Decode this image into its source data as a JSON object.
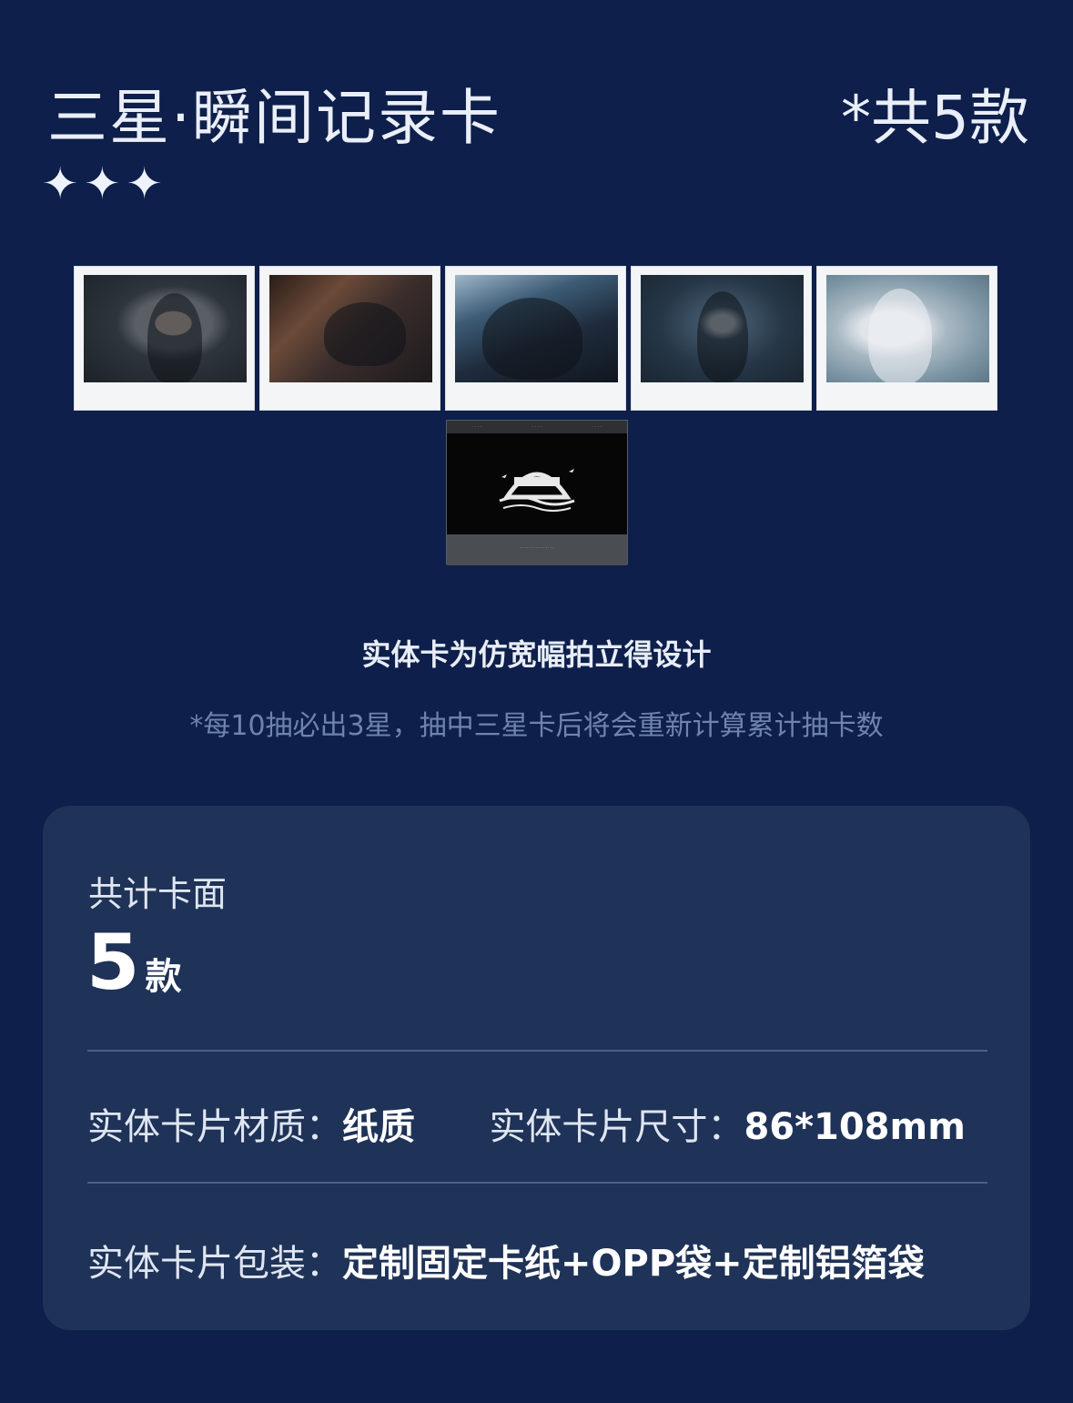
{
  "header": {
    "title": "三星·瞬间记录卡",
    "count_tag": "*共5款",
    "stars": "✦✦✦"
  },
  "cards": [
    {
      "name": "card-1"
    },
    {
      "name": "card-2"
    },
    {
      "name": "card-3"
    },
    {
      "name": "card-4"
    },
    {
      "name": "card-5"
    }
  ],
  "captions": {
    "design_note": "实体卡为仿宽幅拍立得设计",
    "rate_note": "*每10抽必出3星，抽中三星卡后将会重新计算累计抽卡数"
  },
  "panel": {
    "total_label": "共计卡面",
    "total_value": "5",
    "total_unit": "款",
    "material_label": "实体卡片材质：",
    "material_value": "纸质",
    "size_label": "实体卡片尺寸：",
    "size_value": "86*108mm",
    "packaging_label": "实体卡片包装：",
    "packaging_value": "定制固定卡纸+OPP袋+定制铝箔袋"
  },
  "colors": {
    "background": "#0d1f4a",
    "panel": "#1f3257",
    "muted_text": "#6f84ad"
  }
}
